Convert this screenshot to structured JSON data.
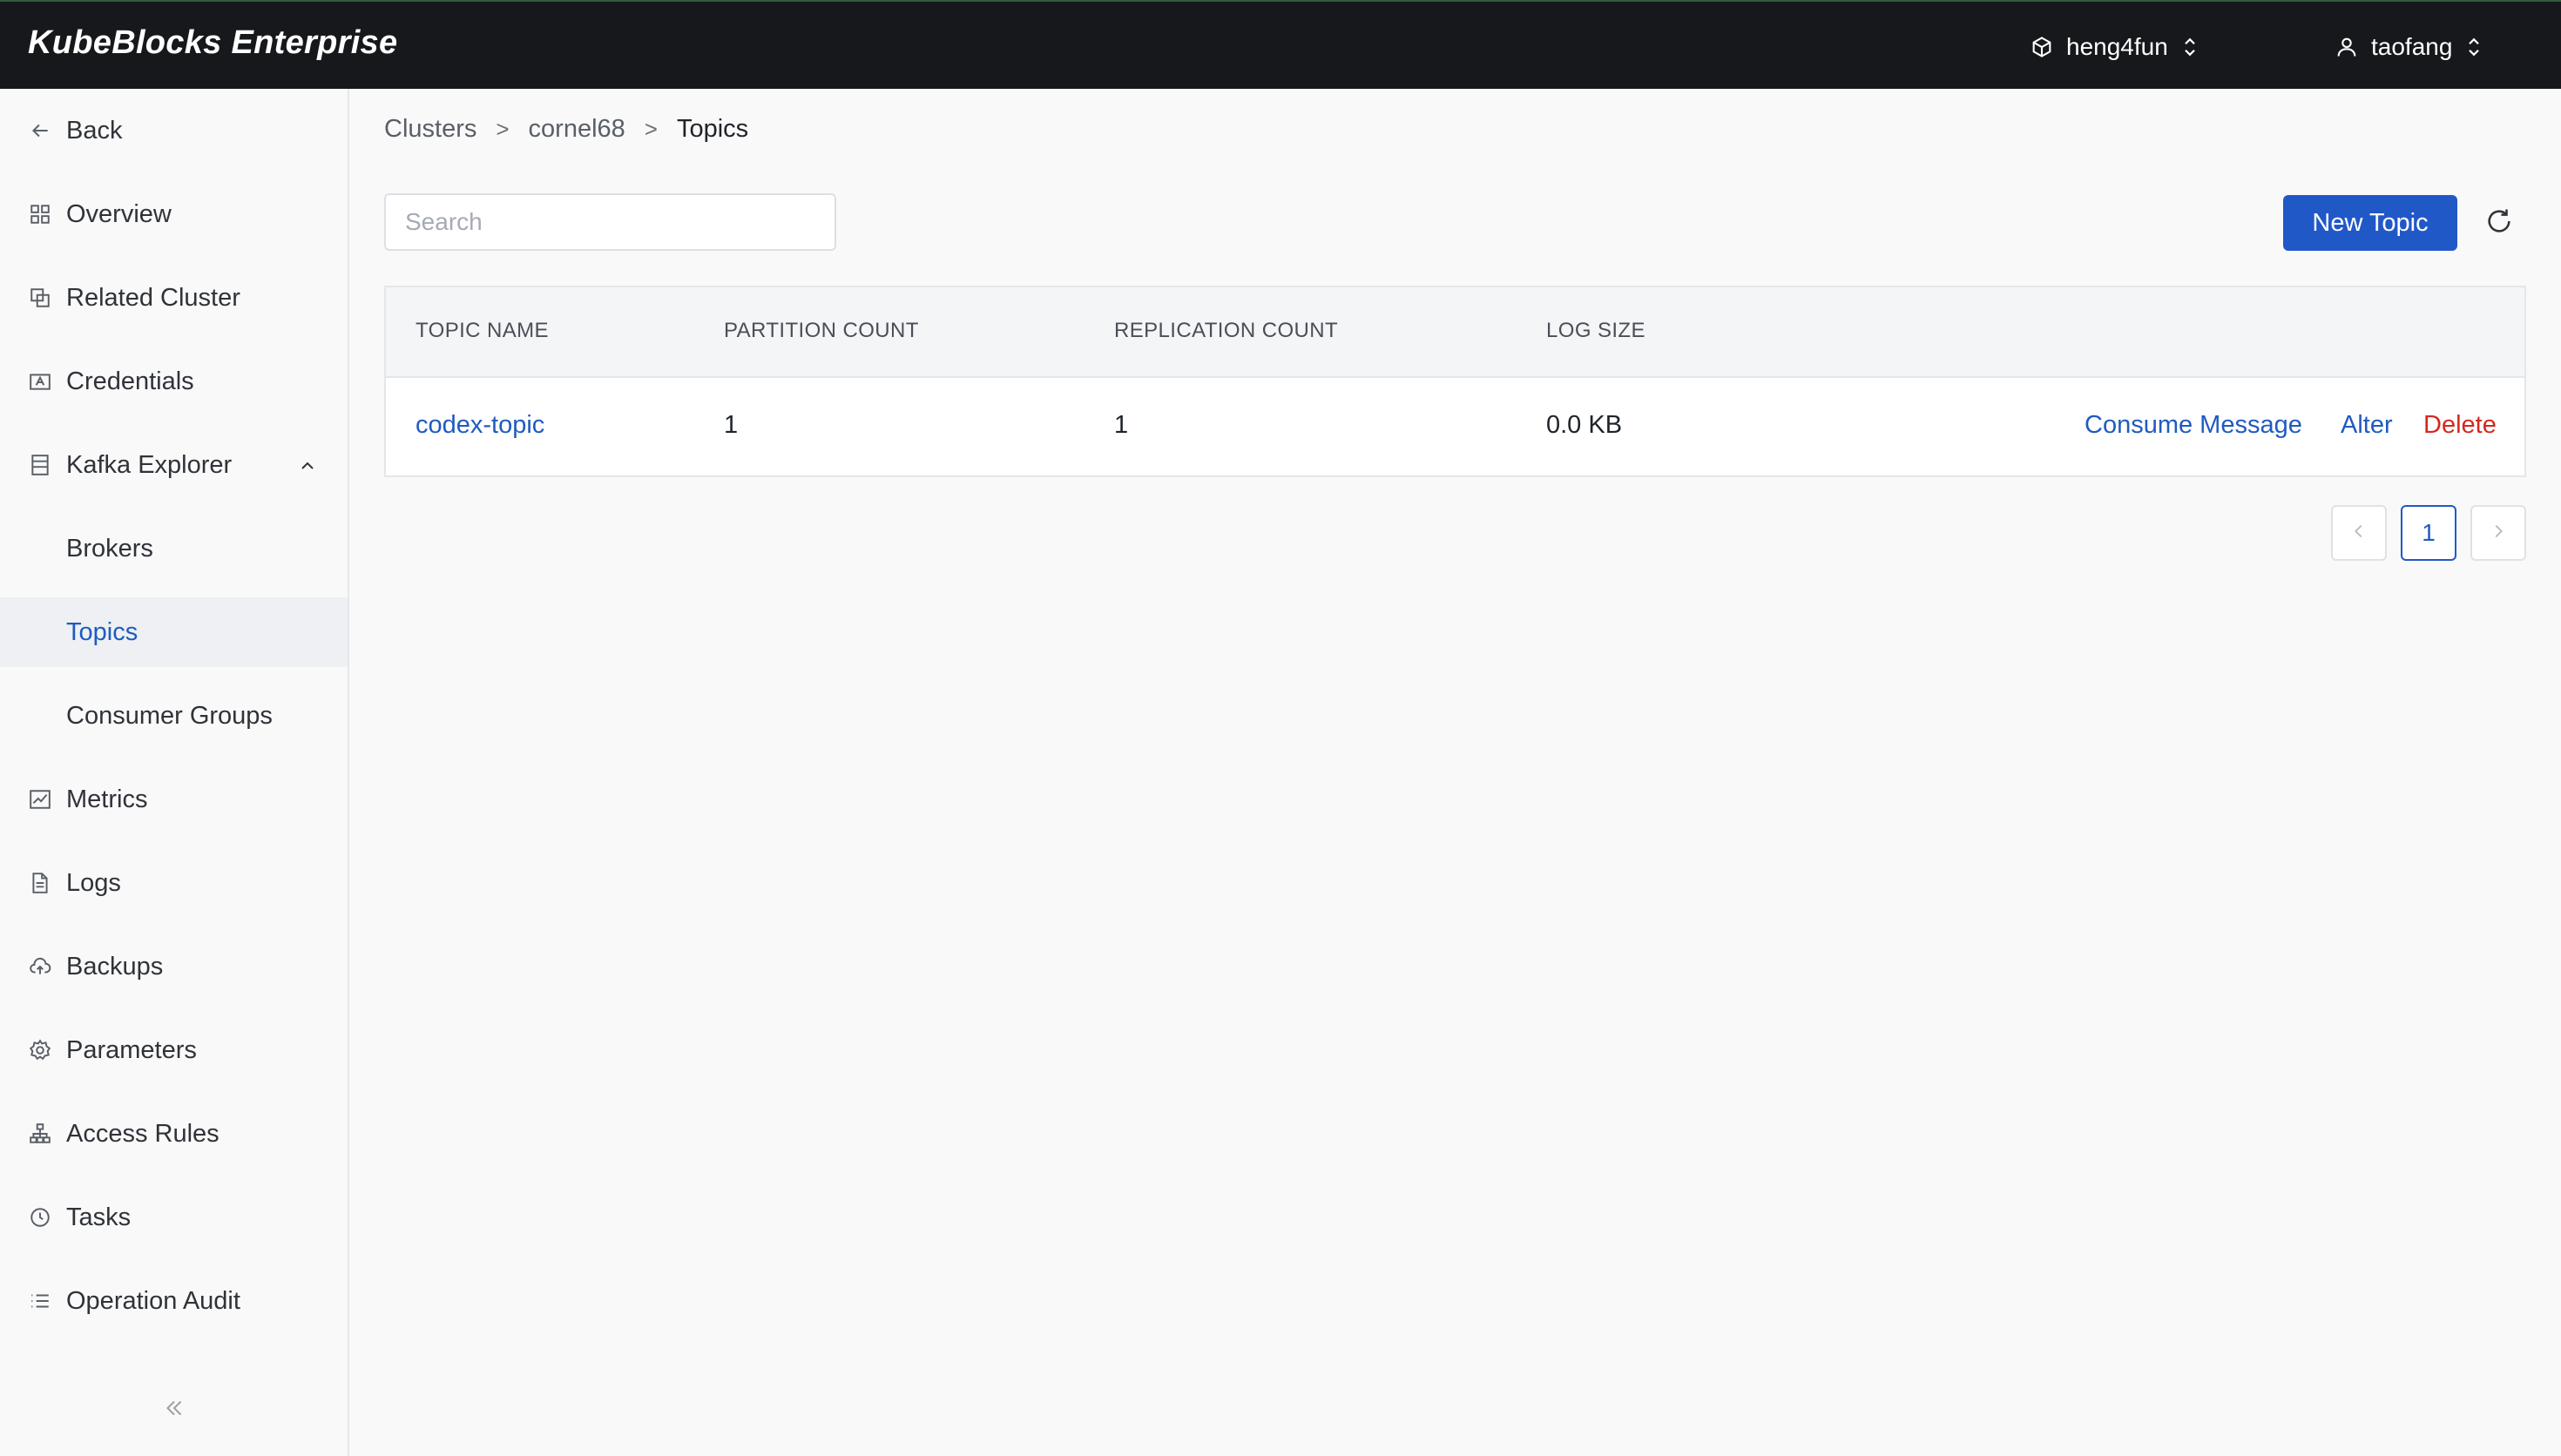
{
  "header": {
    "brand": "KubeBlocks Enterprise",
    "org": {
      "label": "heng4fun",
      "icon": "org-icon"
    },
    "user": {
      "label": "taofang",
      "icon": "user-icon"
    }
  },
  "sidebar": {
    "items": [
      {
        "label": "Back",
        "icon": "arrow-left-icon"
      },
      {
        "label": "Overview",
        "icon": "grid-icon"
      },
      {
        "label": "Related Cluster",
        "icon": "copy-icon"
      },
      {
        "label": "Credentials",
        "icon": "id-card-icon"
      },
      {
        "label": "Kafka Explorer",
        "icon": "database-icon",
        "expanded": true
      },
      {
        "label": "Brokers"
      },
      {
        "label": "Topics",
        "active": true
      },
      {
        "label": "Consumer Groups"
      },
      {
        "label": "Metrics",
        "icon": "chart-icon"
      },
      {
        "label": "Logs",
        "icon": "file-icon"
      },
      {
        "label": "Backups",
        "icon": "cloud-upload-icon"
      },
      {
        "label": "Parameters",
        "icon": "gear-icon"
      },
      {
        "label": "Access Rules",
        "icon": "network-icon"
      },
      {
        "label": "Tasks",
        "icon": "clock-icon"
      },
      {
        "label": "Operation Audit",
        "icon": "list-icon"
      }
    ],
    "collapse_icon": "double-chevron-left-icon"
  },
  "breadcrumb": [
    "Clusters",
    "cornel68",
    "Topics"
  ],
  "breadcrumb_separator": ">",
  "search": {
    "placeholder": "Search",
    "value": ""
  },
  "actions": {
    "new_topic": "New Topic",
    "refresh_icon": "refresh-icon"
  },
  "table": {
    "columns": [
      "TOPIC NAME",
      "PARTITION COUNT",
      "REPLICATION COUNT",
      "LOG SIZE"
    ],
    "rows": [
      {
        "topic_name": "codex-topic",
        "partition_count": "1",
        "replication_count": "1",
        "log_size": "0.0 KB",
        "actions": [
          "Consume Message",
          "Alter",
          "Delete"
        ]
      }
    ]
  },
  "pagination": {
    "current_page": "1"
  },
  "colors": {
    "accent": "#2158c8",
    "link": "#1f5bbf",
    "danger": "#d4281e",
    "header_bg": "#17181c"
  }
}
